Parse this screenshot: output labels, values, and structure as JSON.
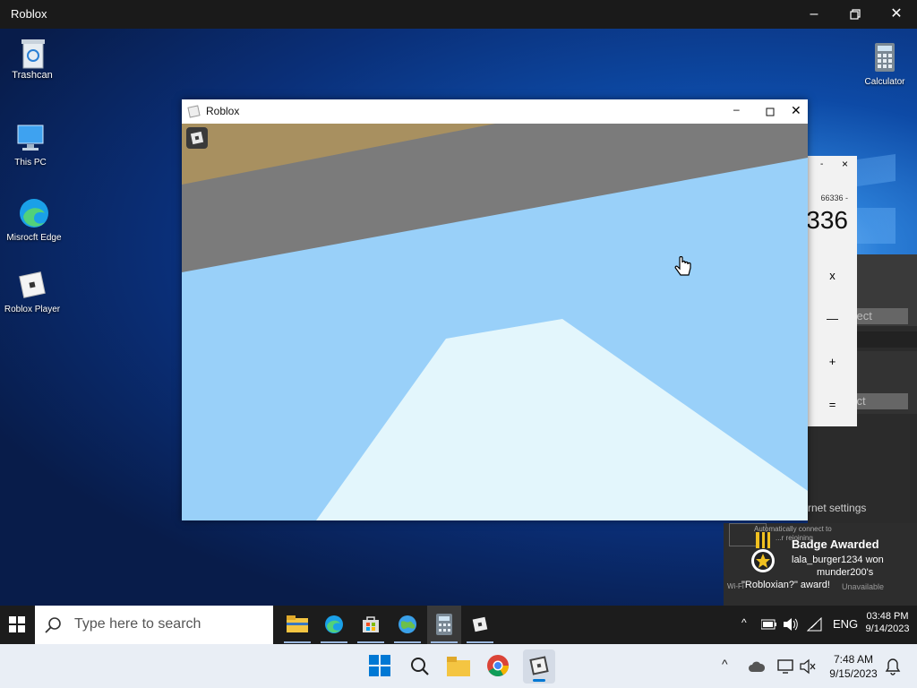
{
  "outer_window": {
    "title": "Roblox"
  },
  "desktop": {
    "icons": [
      {
        "label": "Trashcan"
      },
      {
        "label": "This PC"
      },
      {
        "label": "Misrocft Edge"
      },
      {
        "label": "Roblox Player"
      },
      {
        "label": "Calculator"
      }
    ]
  },
  "roblox_window": {
    "title": "Roblox"
  },
  "calculator": {
    "history": "66336 -",
    "display": "336",
    "ops": [
      "x",
      "—",
      "+",
      "="
    ],
    "close": "×",
    "minimize": "-"
  },
  "network_panel": {
    "connect1": "nnect",
    "connect2": "nect",
    "internet_settings": "rnet settings",
    "auto_connect": "Automatically connect to",
    "auto_connect2": "...r rejoining",
    "unavailable": "Unavailable",
    "wifi": "Wi-Fi"
  },
  "badge": {
    "title": "Badge Awarded",
    "line1": "lala_burger1234 won",
    "line2": "munder200's",
    "line3": "\"Robloxian?\" award!"
  },
  "taskbar1": {
    "search_placeholder": "Type here to search",
    "lang": "ENG",
    "time": "03:48 PM",
    "date": "9/14/2023",
    "chevron": "^"
  },
  "taskbar2": {
    "time": "7:48 AM",
    "date": "9/15/2023",
    "chevron": "^"
  },
  "colors": {
    "accent": "#0078d4",
    "taskbar_dark": "#1c1c1c",
    "taskbar_light": "#e9eef5"
  }
}
